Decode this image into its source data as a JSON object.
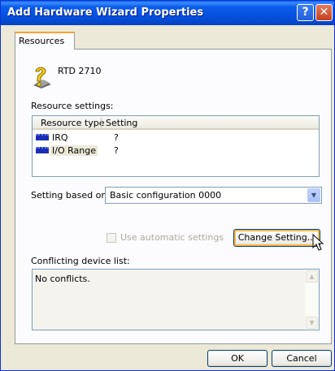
{
  "window": {
    "title": "Add Hardware Wizard Properties",
    "help_glyph": "?",
    "close_glyph": "✕"
  },
  "tabs": [
    {
      "label": "Resources"
    }
  ],
  "device": {
    "name": "RTD 2710"
  },
  "resources": {
    "label": "Resource settings:",
    "columns": [
      "Resource type",
      "Setting"
    ],
    "rows": [
      {
        "type": "IRQ",
        "setting": "?"
      },
      {
        "type": "I/O Range",
        "setting": "?"
      }
    ]
  },
  "setting_based_on": {
    "label": "Setting based on:",
    "value": "Basic configuration 0000"
  },
  "auto_settings": {
    "label": "Use automatic settings",
    "checked": false,
    "enabled": false
  },
  "change_setting_button": "Change Setting...",
  "conflicts": {
    "label": "Conflicting device list:",
    "text": "No conflicts."
  },
  "footer": {
    "ok": "OK",
    "cancel": "Cancel"
  },
  "icons": {
    "device": "question-device-icon",
    "resource": "resource-chip-icon"
  }
}
